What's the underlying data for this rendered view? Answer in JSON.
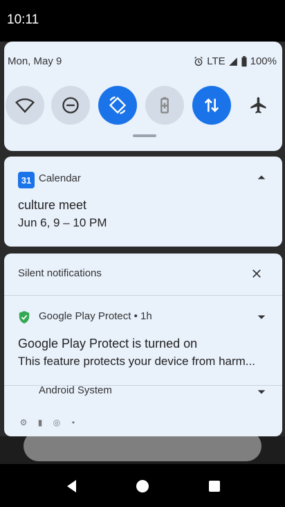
{
  "status_bar": {
    "time": "10:11"
  },
  "quick_settings": {
    "date": "Mon, May 9",
    "network": "LTE",
    "battery": "100%",
    "tiles": [
      {
        "name": "wifi",
        "state": "off"
      },
      {
        "name": "do-not-disturb",
        "state": "off"
      },
      {
        "name": "auto-rotate",
        "state": "on"
      },
      {
        "name": "battery-saver",
        "state": "off"
      },
      {
        "name": "mobile-data",
        "state": "on"
      },
      {
        "name": "airplane-mode",
        "state": "off"
      }
    ]
  },
  "calendar_notification": {
    "app": "Calendar",
    "badge": "31",
    "title": "culture meet",
    "when": "Jun 6, 9 – 10 PM"
  },
  "silent_notifications": {
    "header": "Silent notifications",
    "play_protect": {
      "app": "Google Play Protect • 1h",
      "title": "Google Play Protect is turned on",
      "text": "This feature protects your device from harm..."
    },
    "android_system": {
      "app": "Android System"
    }
  },
  "colors": {
    "accent": "#1a73e8",
    "panel": "#e9f1fb"
  }
}
